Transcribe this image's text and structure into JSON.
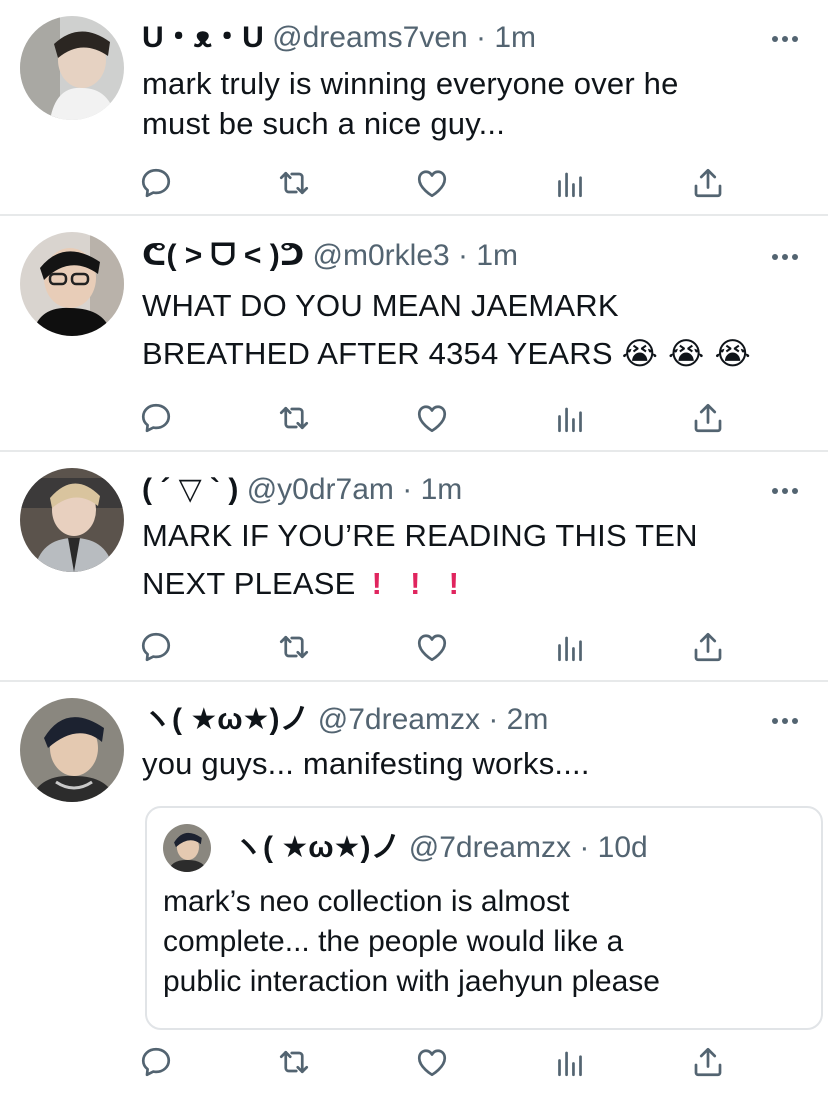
{
  "tweets": [
    {
      "name": "U・ᴥ・U",
      "handle": "@dreams7ven",
      "separator": "·",
      "time": "1m",
      "lines": [
        "mark truly is winning everyone over he",
        "must be such a nice guy..."
      ]
    },
    {
      "name": "ᕦ( ˃ ᗜ ˂ )ᕤ",
      "handle": "@m0rkle3",
      "separator": "·",
      "time": "1m",
      "lines": [
        "WHAT DO YOU MEAN JAEMARK",
        "BREATHED AFTER 4354 YEARS"
      ],
      "emoji": "😭 😭 😭"
    },
    {
      "name": "( ´ ▽ ` )",
      "handle": "@y0dr7am",
      "separator": "·",
      "time": "1m",
      "lines": [
        "MARK IF YOU’RE READING THIS TEN",
        "NEXT PLEASE"
      ],
      "marks": [
        "!",
        "!",
        "!"
      ]
    },
    {
      "name": "ヽ( ★ω★)ノ",
      "handle": "@7dreamzx",
      "separator": "·",
      "time": "2m",
      "lines": [
        "you guys... manifesting works...."
      ],
      "quote": {
        "name": "ヽ( ★ω★)ノ",
        "handle": "@7dreamzx",
        "separator": "·",
        "time": "10d",
        "lines": [
          "mark’s neo collection is almost",
          "complete... the people would like a",
          "public interaction with jaehyun please"
        ]
      }
    }
  ],
  "actions": [
    "reply-icon",
    "retweet-icon",
    "like-icon",
    "analytics-icon",
    "share-icon"
  ],
  "colors": {
    "text": "#0f1419",
    "secondary": "#536471",
    "divider": "#e7e9ea",
    "mark": "#e0245e"
  }
}
